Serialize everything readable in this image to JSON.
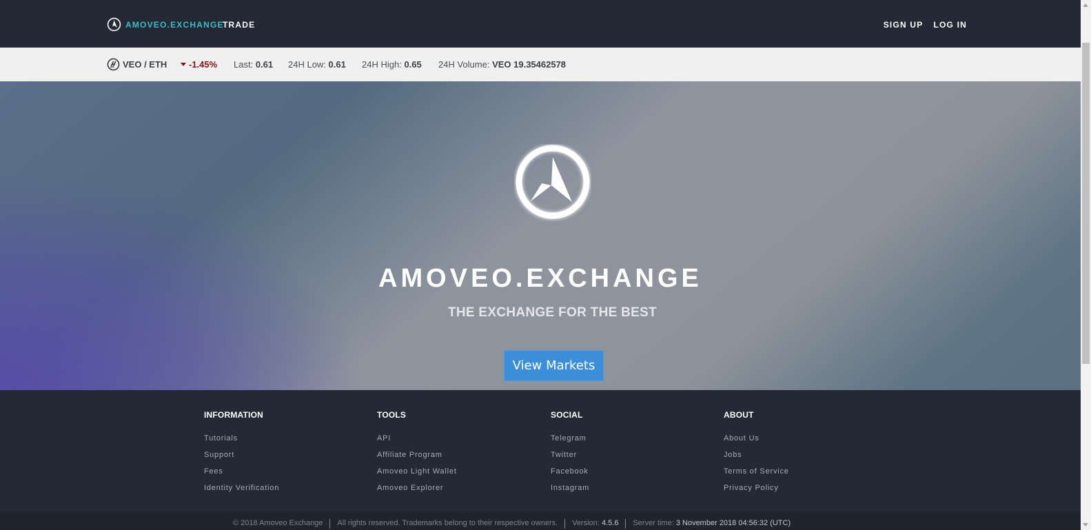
{
  "nav": {
    "brand": "AMOVEO.EXCHANGE",
    "trade": "TRADE",
    "sign_up": "SIGN UP",
    "log_in": "LOG IN"
  },
  "ticker": {
    "pair": "VEO / ETH",
    "change": "-1.45%",
    "last_label": "Last:",
    "last_value": "0.61",
    "low_label": "24H Low:",
    "low_value": "0.61",
    "high_label": "24H High:",
    "high_value": "0.65",
    "volume_label": "24H Volume:",
    "volume_value": "VEO 19.35462578"
  },
  "hero": {
    "title": "AMOVEO.EXCHANGE",
    "subtitle": "THE EXCHANGE FOR THE BEST",
    "cta": "View Markets"
  },
  "footer": {
    "columns": [
      {
        "title": "INFORMATION",
        "links": [
          "Tutorials",
          "Support",
          "Fees",
          "Identity Verification"
        ]
      },
      {
        "title": "TOOLS",
        "links": [
          "API",
          "Affiliate Program",
          "Amoveo Light Wallet",
          "Amoveo Explorer"
        ]
      },
      {
        "title": "SOCIAL",
        "links": [
          "Telegram",
          "Twitter",
          "Facebook",
          "Instagram"
        ]
      },
      {
        "title": "ABOUT",
        "links": [
          "About Us",
          "Jobs",
          "Terms of Service",
          "Privacy Policy"
        ]
      }
    ],
    "copyright": "© 2018 Amoveo Exchange",
    "rights": "All rights reserved. Trademarks belong to their respective owners.",
    "version_label": "Version:",
    "version_value": "4.5.6",
    "server_label": "Server time:",
    "server_value": "3 November 2018 04:56:32 (UTC)"
  },
  "colors": {
    "brand": "#3fbac9",
    "dark_bg": "#232a35",
    "negative": "#8b0f12",
    "cta": "#3c8fd6"
  },
  "icons": {
    "brand": "amoveo-logo-icon",
    "pair": "veo-coin-icon",
    "change": "triangle-down-icon",
    "hero": "amoveo-emblem-icon"
  }
}
